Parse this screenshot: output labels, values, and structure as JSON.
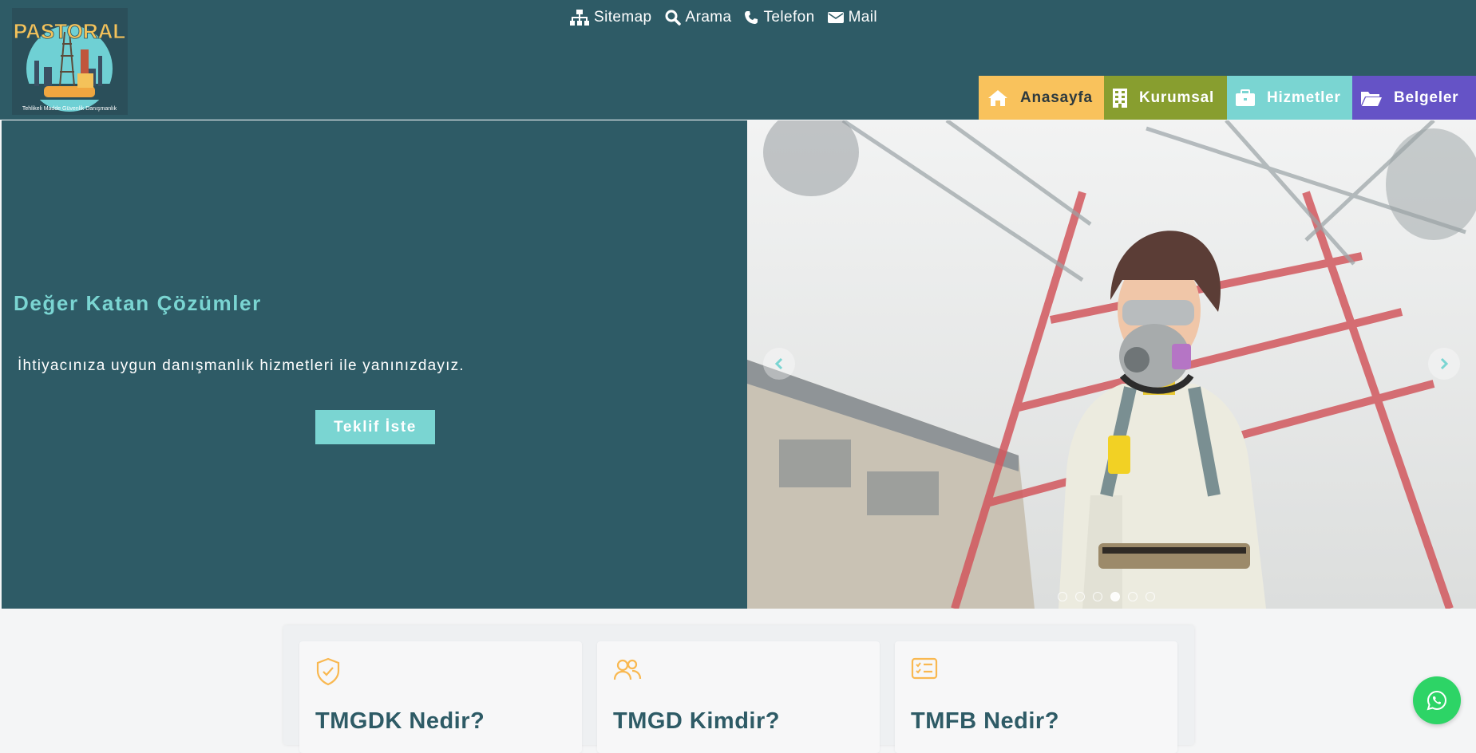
{
  "header": {
    "logo_text": "PASTORAL",
    "logo_tagline": "Tehlikeli Madde Güvenlik Danışmanlık",
    "top_links": [
      {
        "label": "Sitemap",
        "icon": "sitemap-icon"
      },
      {
        "label": "Arama",
        "icon": "search-icon"
      },
      {
        "label": "Telefon",
        "icon": "phone-icon"
      },
      {
        "label": "Mail",
        "icon": "mail-icon"
      }
    ],
    "nav": [
      {
        "label": "Anasayfa",
        "icon": "home-icon",
        "color": "#f9c25c"
      },
      {
        "label": "Kurumsal",
        "icon": "building-icon",
        "color": "#889e2f"
      },
      {
        "label": "Hizmetler",
        "icon": "briefcase-icon",
        "color": "#7ad5d2"
      },
      {
        "label": "Belgeler",
        "icon": "folder-icon",
        "color": "#6553c6"
      }
    ]
  },
  "hero": {
    "title": "Değer Katan Çözümler",
    "subtitle": "İhtiyacınıza uygun danışmanlık hizmetleri ile yanınızdayız.",
    "cta_label": "Teklif İste",
    "slide_count": 6,
    "active_slide": 4
  },
  "cards": [
    {
      "title": "TMGDK Nedir?",
      "icon": "shield-check-icon"
    },
    {
      "title": "TMGD Kimdir?",
      "icon": "users-icon"
    },
    {
      "title": "TMFB Nedir?",
      "icon": "checklist-icon"
    }
  ],
  "colors": {
    "header_bg": "#2e5b66",
    "accent_teal": "#7ad5d2",
    "accent_orange": "#f9c25c",
    "whatsapp": "#2dd466"
  }
}
